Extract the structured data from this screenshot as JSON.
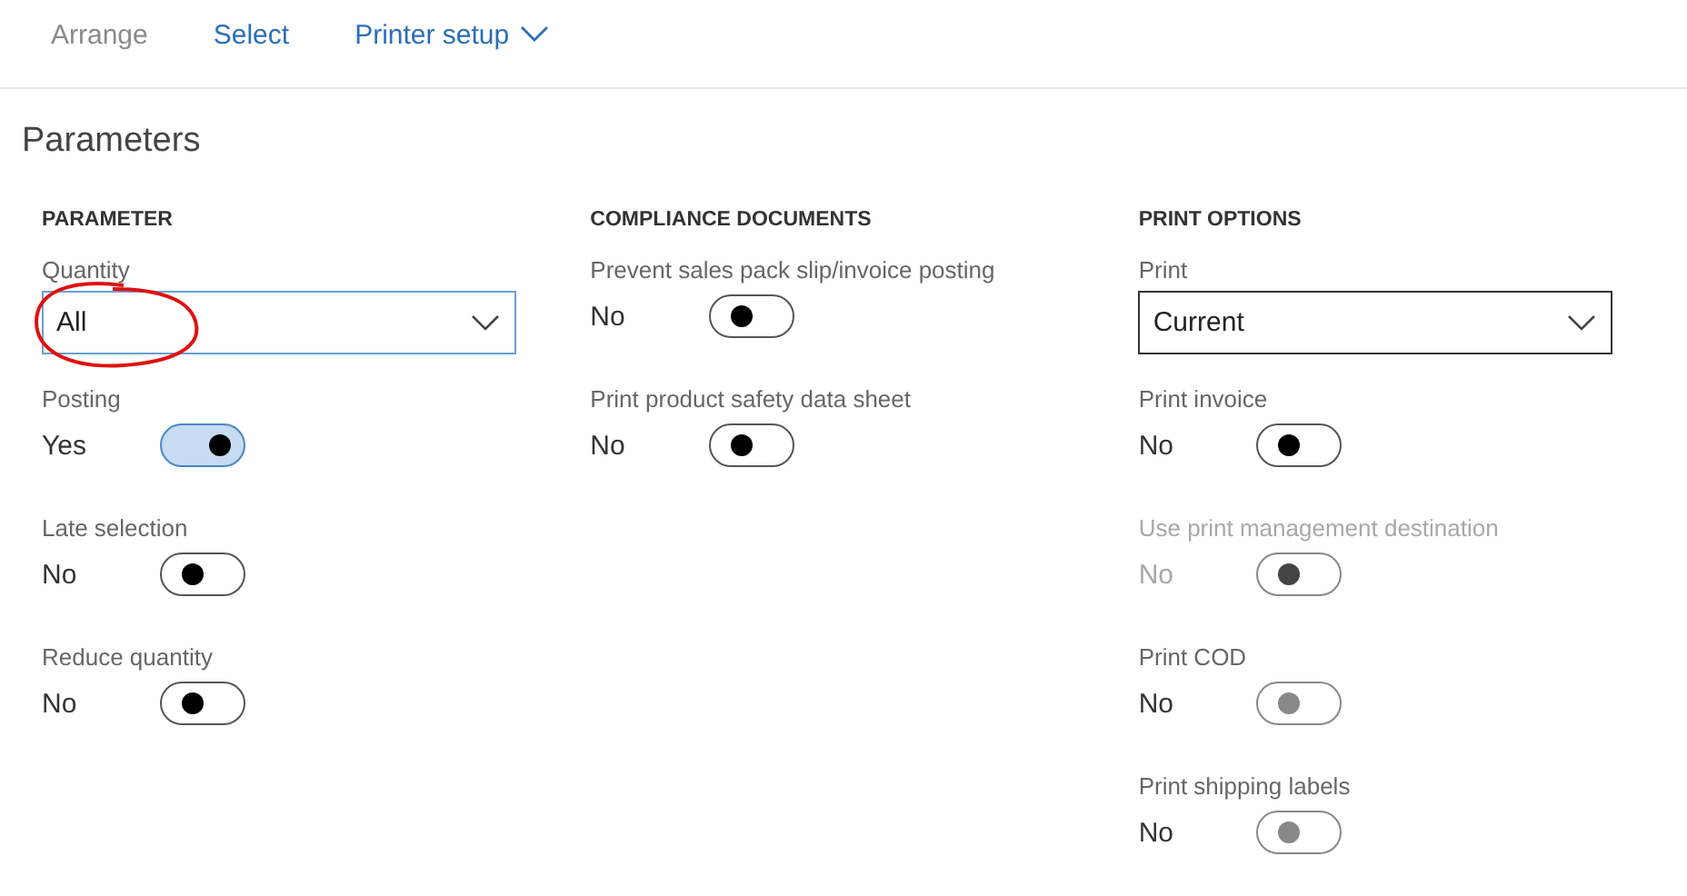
{
  "toolbar": [
    {
      "label": "Arrange",
      "disabled": true,
      "dropdown": false
    },
    {
      "label": "Select",
      "disabled": false,
      "dropdown": false
    },
    {
      "label": "Printer setup",
      "disabled": false,
      "dropdown": true
    }
  ],
  "title": "Parameters",
  "sections": [
    {
      "heading": "PARAMETER",
      "fields": [
        {
          "kind": "dropdown",
          "label": "Quantity",
          "value": "All",
          "focused": true,
          "circled": true
        },
        {
          "kind": "toggle",
          "label": "Posting",
          "value": "Yes",
          "on": true,
          "disabled": false,
          "dimmed": false
        },
        {
          "kind": "toggle",
          "label": "Late selection",
          "value": "No",
          "on": false,
          "disabled": false,
          "dimmed": false
        },
        {
          "kind": "toggle",
          "label": "Reduce quantity",
          "value": "No",
          "on": false,
          "disabled": false,
          "dimmed": false
        }
      ]
    },
    {
      "heading": "COMPLIANCE DOCUMENTS",
      "fields": [
        {
          "kind": "toggle",
          "label": "Prevent sales pack slip/invoice posting",
          "value": "No",
          "on": false,
          "disabled": false,
          "dimmed": false
        },
        {
          "kind": "toggle",
          "label": "Print product safety data sheet",
          "value": "No",
          "on": false,
          "disabled": false,
          "dimmed": false
        }
      ]
    },
    {
      "heading": "PRINT OPTIONS",
      "fields": [
        {
          "kind": "dropdown",
          "label": "Print",
          "value": "Current",
          "focused": false,
          "circled": false
        },
        {
          "kind": "toggle",
          "label": "Print invoice",
          "value": "No",
          "on": false,
          "disabled": false,
          "dimmed": false
        },
        {
          "kind": "toggle",
          "label": "Use print management destination",
          "value": "No",
          "on": false,
          "disabled": true,
          "dimmed": true
        },
        {
          "kind": "toggle",
          "label": "Print COD",
          "value": "No",
          "on": false,
          "disabled": true,
          "dimmed": false
        },
        {
          "kind": "toggle",
          "label": "Print shipping labels",
          "value": "No",
          "on": false,
          "disabled": true,
          "dimmed": false
        }
      ]
    }
  ]
}
